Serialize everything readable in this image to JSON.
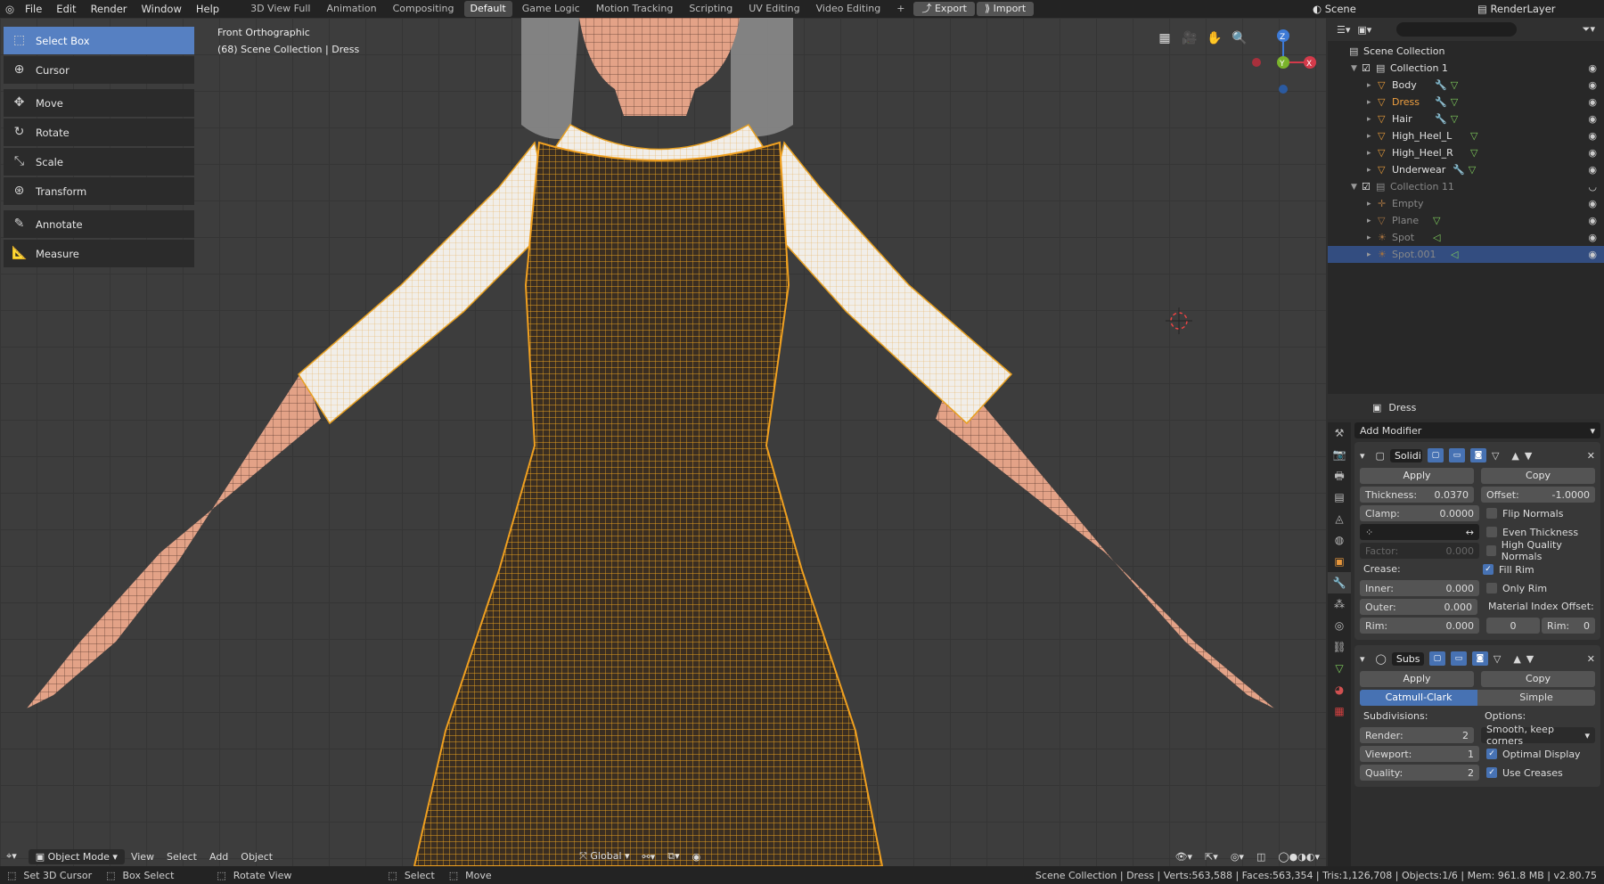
{
  "menu": {
    "items": [
      "File",
      "Edit",
      "Render",
      "Window",
      "Help"
    ]
  },
  "workspaces": [
    "3D View Full",
    "Animation",
    "Compositing",
    "Default",
    "Game Logic",
    "Motion Tracking",
    "Scripting",
    "UV Editing",
    "Video Editing"
  ],
  "active_workspace": "Default",
  "top_buttons": {
    "export": "Export",
    "import": "Import"
  },
  "scene": "Scene",
  "render_layer": "RenderLayer",
  "viewport": {
    "view_name": "Front Orthographic",
    "collection_path": "(68) Scene Collection | Dress"
  },
  "tools": [
    "Select Box",
    "Cursor",
    "Move",
    "Rotate",
    "Scale",
    "Transform",
    "Annotate",
    "Measure"
  ],
  "gizmo": {
    "z": "Z",
    "y": "Y",
    "x": "X"
  },
  "header_bottom": {
    "mode": "Object Mode",
    "view": "View",
    "select": "Select",
    "add": "Add",
    "object": "Object",
    "orientation": "Global"
  },
  "outliner": {
    "root": "Scene Collection",
    "rows": [
      {
        "name": "Collection 1",
        "level": 1
      },
      {
        "name": "Body",
        "level": 2
      },
      {
        "name": "Dress",
        "level": 2
      },
      {
        "name": "Hair",
        "level": 2
      },
      {
        "name": "High_Heel_L",
        "level": 2
      },
      {
        "name": "High_Heel_R",
        "level": 2
      },
      {
        "name": "Underwear",
        "level": 2
      },
      {
        "name": "Collection 11",
        "level": 1
      },
      {
        "name": "Empty",
        "level": 2
      },
      {
        "name": "Plane",
        "level": 2
      },
      {
        "name": "Spot",
        "level": 2
      },
      {
        "name": "Spot.001",
        "level": 2
      }
    ]
  },
  "properties": {
    "object_name": "Dress",
    "add_modifier": "Add Modifier",
    "solidify": {
      "name": "Solidi",
      "apply": "Apply",
      "copy": "Copy",
      "thickness_label": "Thickness:",
      "thickness": "0.0370",
      "offset_label": "Offset:",
      "offset": "-1.0000",
      "clamp_label": "Clamp:",
      "clamp": "0.0000",
      "factor_label": "Factor:",
      "factor": "0.000",
      "crease": "Crease:",
      "inner_label": "Inner:",
      "inner": "0.000",
      "outer_label": "Outer:",
      "outer": "0.000",
      "rim_label": "Rim:",
      "rim": "0.000",
      "flip_normals": "Flip Normals",
      "even_thickness": "Even Thickness",
      "hq_normals": "High Quality Normals",
      "fill_rim": "Fill Rim",
      "only_rim": "Only Rim",
      "mat_offset": "Material Index Offset:",
      "mat_val": "0",
      "mat_rim_label": "Rim:",
      "mat_rim": "0"
    },
    "subsurf": {
      "name": "Subs",
      "apply": "Apply",
      "copy": "Copy",
      "catmull": "Catmull-Clark",
      "simple": "Simple",
      "subdivisions": "Subdivisions:",
      "options": "Options:",
      "render_label": "Render:",
      "render": "2",
      "viewport_label": "Viewport:",
      "viewport": "1",
      "quality_label": "Quality:",
      "quality": "2",
      "uv_smooth": "Smooth, keep corners",
      "optimal": "Optimal Display",
      "creases": "Use Creases"
    }
  },
  "status": {
    "set_cursor": "Set 3D Cursor",
    "box_select": "Box Select",
    "rotate_view": "Rotate View",
    "select": "Select",
    "move": "Move",
    "stats": "Scene Collection | Dress | Verts:563,588 | Faces:563,354 | Tris:1,126,708 | Objects:1/6 | Mem: 961.8 MB | v2.80.75"
  }
}
